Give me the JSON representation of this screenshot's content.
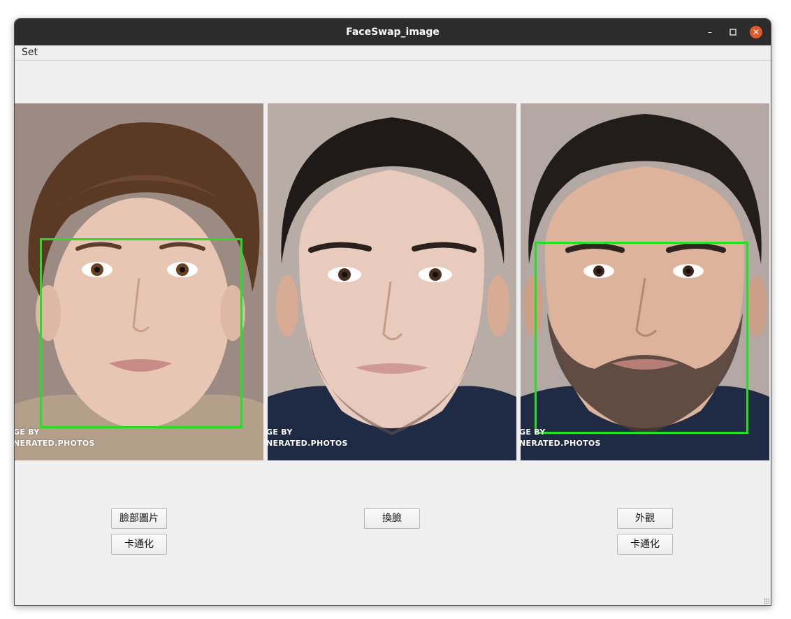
{
  "window": {
    "title": "FaceSwap_image"
  },
  "menu": {
    "items": [
      "Set"
    ]
  },
  "panels": [
    {
      "name": "source-face",
      "watermark_line1": "GE BY",
      "watermark_line2": "NERATED.PHOTOS"
    },
    {
      "name": "swapped-result",
      "watermark_line1": "GE BY",
      "watermark_line2": "NERATED.PHOTOS"
    },
    {
      "name": "target-appearance",
      "watermark_line1": "GE BY",
      "watermark_line2": "NERATED.PHOTOS"
    }
  ],
  "buttons": {
    "face_image": "臉部圖片",
    "cartoon_left": "卡通化",
    "swap_face": "換臉",
    "appearance": "外觀",
    "cartoon_right": "卡通化"
  },
  "colors": {
    "titlebar": "#2c2c2c",
    "window_bg": "#efefef",
    "detection_box": "#22e022",
    "close_button": "#e05a2b"
  },
  "icons": {
    "minimize": "minimize-icon",
    "maximize": "maximize-icon",
    "close": "close-icon"
  }
}
